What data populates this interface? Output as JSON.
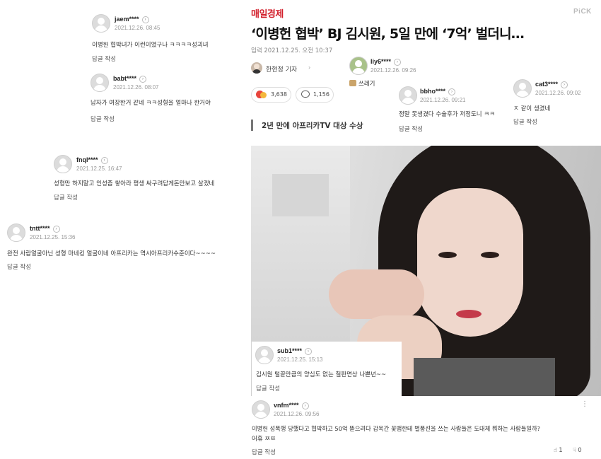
{
  "article": {
    "brand": "매일경제",
    "pick": "PiCK",
    "headline": "‘이병헌 협박’ BJ 김시원, 5일 만에 ‘7억’ 벌더니…",
    "date_label": "입력 2021.12.25. 오전 10:37",
    "reporter": "한현정 기자",
    "reaction_count": "3,638",
    "comment_count": "1,156",
    "subheading": "2년 만에 아프리카TV 대상 수상"
  },
  "reply_label": "답글 작성",
  "comments": [
    {
      "user": "jaem****",
      "time": "2021.12.26. 08:45",
      "text": "이병헌 협박녀가 이런이였구나 ㅋㅋㅋㅋ성괴녀"
    },
    {
      "user": "babt****",
      "time": "2021.12.26. 08:07",
      "text": "남자가 여장한거 같네 ㅋㅋ성형을 얼마나 한거야"
    },
    {
      "user": "fnql****",
      "time": "2021.12.25. 16:47",
      "text": "성형만 하지말고 인성좀 쌓아라 평생 싸구려답게돈만보고 살겠네"
    },
    {
      "user": "tntt****",
      "time": "2021.12.25. 15:36",
      "text": "완전 사람얼굴아닌 성형 마네킹 얼굴이네 아프리카는 역시아프리카수준이다~~~~"
    },
    {
      "user": "liy6****",
      "time": "2021.12.26. 09:26",
      "text": "쓰레기"
    },
    {
      "user": "bbho****",
      "time": "2021.12.26. 09:21",
      "text": "정말 못생겼다 수술후가 저정도니 ㅋㅋ"
    },
    {
      "user": "cat3****",
      "time": "2021.12.26. 09:02",
      "text": "ㅈ 같이 생겼네"
    },
    {
      "user": "sub1****",
      "time": "2021.12.25. 15:13",
      "text": "김시원 털끝만큼의 양심도 없는 철판면상 나쁜년~~"
    },
    {
      "user": "vnfm****",
      "time": "2021.12.26. 09:56",
      "text_line1": "이병헌 성폭행 당했다고 협박하고 50억 뜯으려다 감옥간 꽃뱀한테 별풍선을 쓰는 사람들은 도대체 뭐하는 사람들일까?",
      "text_line2": "어휴 ㅉㅉ",
      "likes": "1",
      "dislikes": "0"
    }
  ],
  "icons": {
    "user_avatar": "default-avatar-icon",
    "chevron": "chevron-right-icon",
    "reaction": "emoji-reaction-icon",
    "comment": "speech-bubble-icon",
    "more": "more-vertical-icon",
    "like": "thumbs-up-icon",
    "dislike": "thumbs-down-icon"
  },
  "colors": {
    "brand": "#d21f2b",
    "muted": "#999999"
  }
}
